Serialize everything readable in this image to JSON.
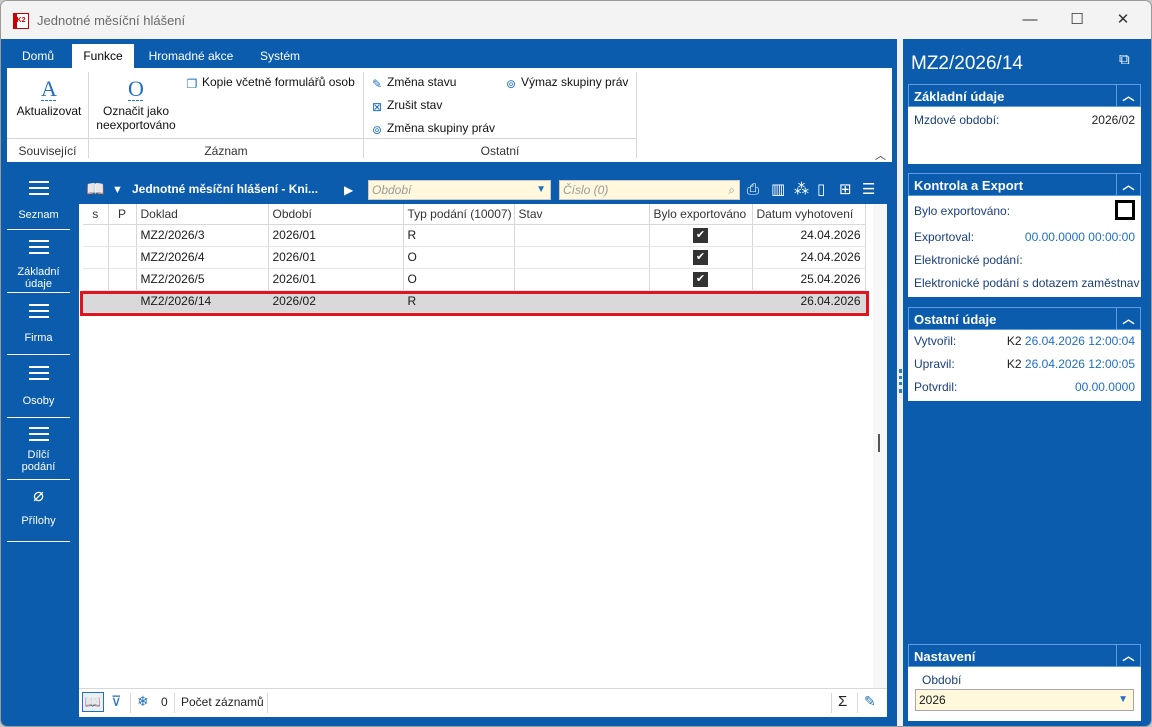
{
  "window": {
    "title": "Jednotné měsíční hlášení",
    "logo_text": "K2",
    "buttons": {
      "minimize": "—",
      "maximize": "☐",
      "close": "✕"
    }
  },
  "ribbon": {
    "tabs": [
      "Domů",
      "Funkce",
      "Hromadné akce",
      "Systém"
    ],
    "active_tab": "Funkce",
    "buttons": {
      "refresh": "Aktualizovat",
      "mark_not_exported_1": "Označit jako",
      "mark_not_exported_2": "neexportováno",
      "copy_forms": "Kopie včetně formulářů osob",
      "change_state": "Změna stavu",
      "cancel_state": "Zrušit stav",
      "change_rights_group": "Změna skupiny práv",
      "delete_rights_group": "Výmaz skupiny práv"
    },
    "icons": {
      "refresh": "A",
      "mark": "O"
    },
    "groups": [
      "Související",
      "Záznam",
      "Ostatní"
    ]
  },
  "nav": {
    "items": [
      {
        "label": "Seznam"
      },
      {
        "label": "Základní údaje"
      },
      {
        "label": "Firma"
      },
      {
        "label": "Osoby"
      },
      {
        "label": "Dílčí podání"
      },
      {
        "label": "Přílohy"
      }
    ]
  },
  "grid": {
    "title": "Jednotné měsíční hlášení - Kni...",
    "period_placeholder": "Období",
    "number_placeholder": "Číslo (0)",
    "columns": [
      "s",
      "P",
      "Doklad",
      "Období",
      "Typ podání (10007)",
      "Stav",
      "Bylo exportováno",
      "Datum vyhotovení"
    ],
    "rows": [
      {
        "doklad": "MZ2/2026/3",
        "obdobi": "2026/01",
        "typ": "R",
        "stav": "",
        "exported": true,
        "datum": "24.04.2026"
      },
      {
        "doklad": "MZ2/2026/4",
        "obdobi": "2026/01",
        "typ": "O",
        "stav": "",
        "exported": true,
        "datum": "24.04.2026"
      },
      {
        "doklad": "MZ2/2026/5",
        "obdobi": "2026/01",
        "typ": "O",
        "stav": "",
        "exported": true,
        "datum": "25.04.2026"
      },
      {
        "doklad": "MZ2/2026/14",
        "obdobi": "2026/02",
        "typ": "R",
        "stav": "",
        "exported": false,
        "datum": "26.04.2026"
      }
    ],
    "selected_row": 3,
    "footer": {
      "count": "0",
      "count_label": "Počet záznamů",
      "sum": "Σ"
    }
  },
  "detail": {
    "title": "MZ2/2026/14",
    "sections": {
      "basic": {
        "heading": "Základní údaje",
        "period_label": "Mzdové období:",
        "period_value": "2026/02"
      },
      "export": {
        "heading": "Kontrola a Export",
        "exported_label": "Bylo exportováno:",
        "exported_by_label": "Exportoval:",
        "exported_by_value": "00.00.0000 00:00:00",
        "efiling_label": "Elektronické podání:",
        "efiling_query_label": "Elektronické podání s dotazem zaměstnav"
      },
      "other": {
        "heading": "Ostatní údaje",
        "created_label": "Vytvořil:",
        "created_user": "K2",
        "created_value": "26.04.2026 12:00:04",
        "updated_label": "Upravil:",
        "updated_user": "K2",
        "updated_value": "26.04.2026 12:00:05",
        "confirmed_label": "Potvrdil:",
        "confirmed_value": "00.00.0000"
      },
      "settings": {
        "heading": "Nastavení",
        "period_label": "Období",
        "period_value": "2026"
      }
    }
  },
  "colors": {
    "frame_blue": "#0b5cad",
    "accent_blue": "#1f6fc2",
    "selection_red": "#e0141e",
    "filter_yellow": "#fff8dc"
  }
}
